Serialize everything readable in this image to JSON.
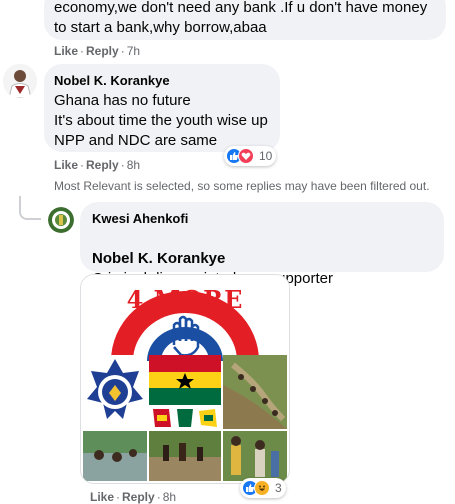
{
  "comments": [
    {
      "text": "economy,we don't need any bank .If u don't have money\nto start a bank,why borrow,abaa",
      "actions": {
        "like": "Like",
        "reply": "Reply",
        "time": "7h"
      }
    },
    {
      "author": "Nobel K. Korankye",
      "text": "Ghana has no future\nIt's about time the youth wise up\nNPP and NDC are same",
      "reaction_count": "10",
      "reactions": [
        "like-icon",
        "love-icon"
      ],
      "actions": {
        "like": "Like",
        "reply": "Reply",
        "time": "8h"
      }
    }
  ],
  "filter_note": "Most Relevant is selected, so some replies may have been filtered out.",
  "reply": {
    "author": "Kwesi Ahenkofi",
    "mention": "Nobel K. Korankye",
    "text": "Criminal disappointed npp supporter",
    "image_banner_text": "4 MORE",
    "reaction_count": "3",
    "reactions": [
      "like-icon",
      "haha-icon"
    ],
    "actions": {
      "like": "Like",
      "reply": "Reply",
      "time": "8h"
    }
  },
  "colors": {
    "like": "#1877f2",
    "love": "#f33e58",
    "haha": "#f7b125",
    "bubble": "#f0f2f5",
    "secondary_text": "#65676b",
    "npp_red": "#e31e24"
  }
}
